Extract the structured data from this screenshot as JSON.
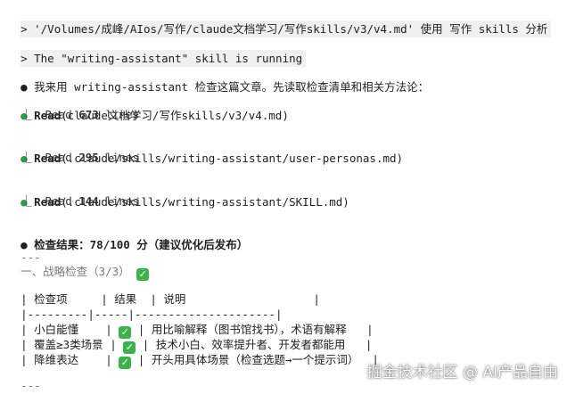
{
  "prompt": {
    "mark": ">",
    "command": "'/Volumes/成峰/AIos/写作/claude文档学习/写作skills/v3/v4.md' 使用 写作 skills 分析"
  },
  "skill_notice": {
    "mark": ">",
    "text": "The \"writing-assistant\" skill is running"
  },
  "message": {
    "bullet": "●",
    "text": "我来用 writing-assistant 检查这篇文章。先读取检查清单和相关方法论："
  },
  "reads": [
    {
      "bullet": "●",
      "tool": "Read",
      "arg": "(claude文档学习/写作skills/v3/v4.md)",
      "result_prefix": "⎿  Read ",
      "result_count": "673",
      "result_suffix": " lines"
    },
    {
      "bullet": "●",
      "tool": "Read",
      "arg": "(.claude/skills/writing-assistant/user-personas.md)",
      "result_prefix": "⎿  Read ",
      "result_count": "295",
      "result_suffix": " lines"
    },
    {
      "bullet": "●",
      "tool": "Read",
      "arg": "(.claude/skills/writing-assistant/SKILL.md)",
      "result_prefix": "⎿  Read ",
      "result_count": "144",
      "result_suffix": " lines"
    }
  ],
  "result": {
    "bullet": "●",
    "text": "检查结果：78/100 分（建议优化后发布）"
  },
  "section": {
    "divider": "---",
    "title": "一、战略检查（3/3）"
  },
  "table": {
    "header": "| 检查项     | 结果  | 说明                   |",
    "separator": "|---------|-----|---------------------|",
    "rows": [
      {
        "pre": "| 小白能懂    | ",
        "post": " | 用比喻解释（图书馆找书），术语有解释   |"
      },
      {
        "pre": "| 覆盖≥3类场景 | ",
        "post": " | 技术小白、效率提升者、开发者都能用   |"
      },
      {
        "pre": "| 降维表达    | ",
        "post": " | 开头用具体场景（检查选题→一个提示词）  |"
      }
    ]
  },
  "trailing_divider": "---",
  "watermark": "掘金技术社区 @ AI产品自由",
  "colors": {
    "accent_green": "#3cb34a",
    "bullet_green": "#2e9c4f"
  },
  "icons": {
    "check": "white-heavy-check-mark"
  }
}
